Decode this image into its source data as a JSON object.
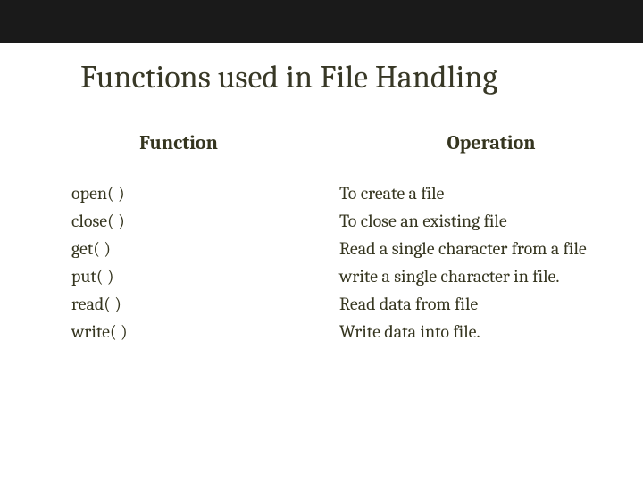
{
  "title": "Functions used in File Handling",
  "headers": {
    "function": "Function",
    "operation": "Operation"
  },
  "rows": [
    {
      "function": "open( )",
      "operation": "To create a file"
    },
    {
      "function": "close( )",
      "operation": "To close an existing file"
    },
    {
      "function": "get( )",
      "operation": "Read a single character from a file"
    },
    {
      "function": "put( )",
      "operation": "write a single character in file."
    },
    {
      "function": "read( )",
      "operation": "Read data from file"
    },
    {
      "function": "write( )",
      "operation": "Write data into file."
    }
  ]
}
